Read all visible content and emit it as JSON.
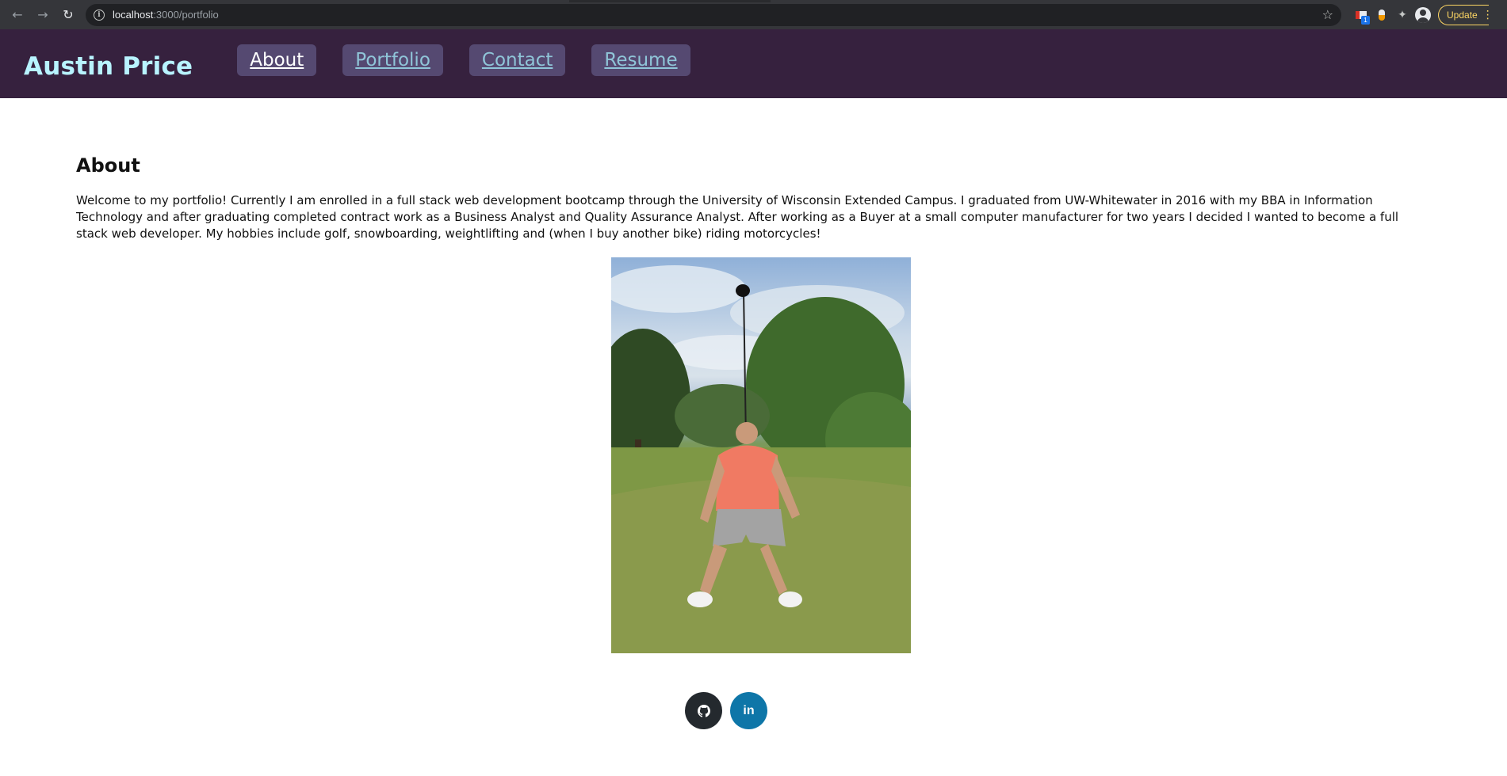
{
  "browser": {
    "url_host": "localhost",
    "url_path": ":3000/portfolio",
    "ext_badge": "1",
    "update_label": "Update"
  },
  "site": {
    "brand": "Austin Price",
    "nav": [
      {
        "label": "About",
        "active": true
      },
      {
        "label": "Portfolio",
        "active": false
      },
      {
        "label": "Contact",
        "active": false
      },
      {
        "label": "Resume",
        "active": false
      }
    ]
  },
  "about": {
    "title": "About",
    "body": "Welcome to my portfolio! Currently I am enrolled in a full stack web development bootcamp through the University of Wisconsin Extended Campus. I graduated from UW-Whitewater in 2016 with my BBA in Information Technology and after graduating completed contract work as a Business Analyst and Quality Assurance Analyst. After working as a Buyer at a small computer manufacturer for two years I decided I wanted to become a full stack web developer. My hobbies include golf, snowboarding, weightlifting and (when I buy another bike) riding motorcycles!",
    "photo": "golf-photo"
  },
  "social": {
    "github_icon": "github-icon",
    "linkedin_label": "in"
  },
  "colors": {
    "header_bg": "#36213e",
    "brand": "#b8f3ff",
    "nav_bg": "#554971",
    "nav_text": "#8fc5d8",
    "github": "#24292e",
    "linkedin": "#0e76a8"
  }
}
